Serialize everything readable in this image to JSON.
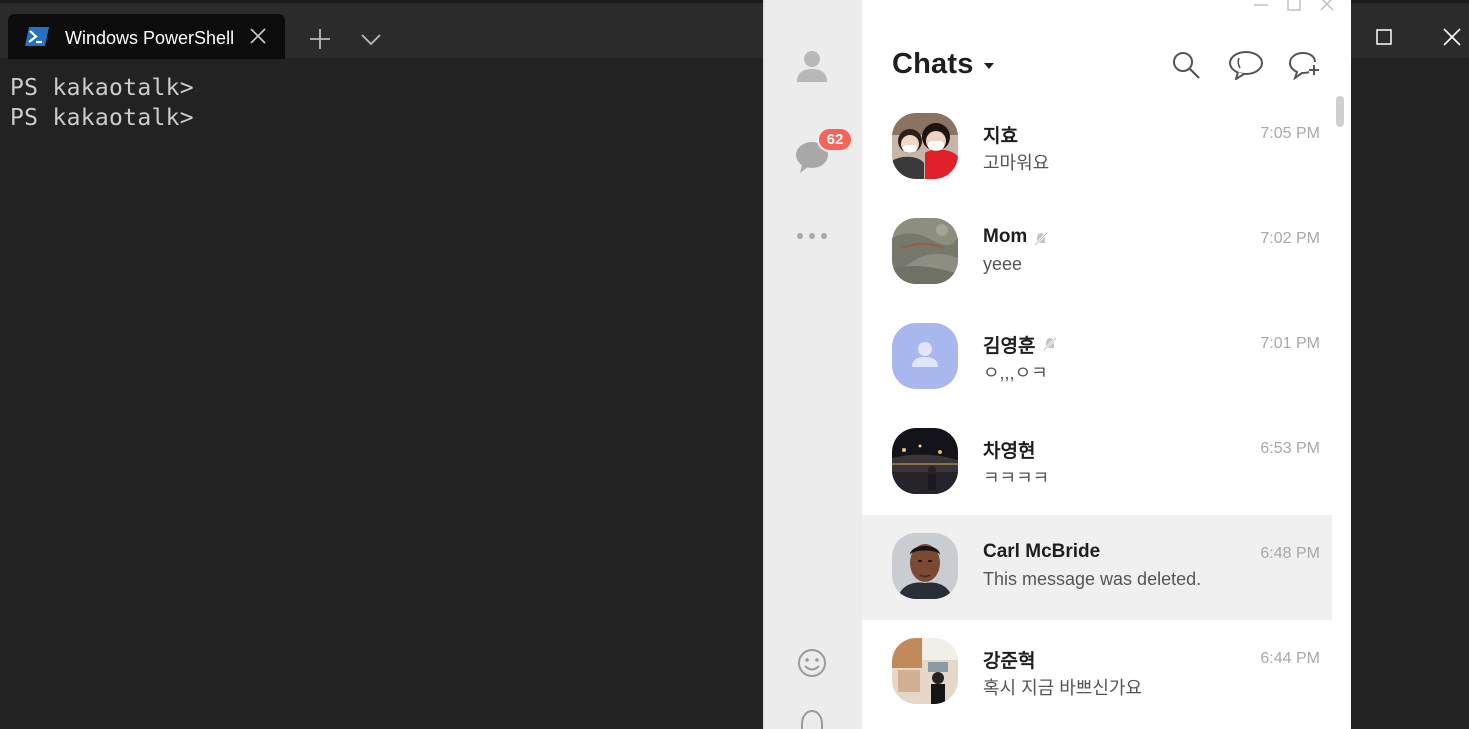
{
  "terminal": {
    "tab_title": "Windows PowerShell",
    "lines": [
      "PS kakaotalk>",
      "PS kakaotalk>"
    ],
    "background": "#0c0c0c"
  },
  "kakao": {
    "title": "Chats",
    "sidebar": {
      "unread_badge": "62",
      "items": [
        "person-icon",
        "chat-bubble-icon",
        "more-dots-icon",
        "emoticon-icon",
        "bell-icon"
      ]
    },
    "toolbar_icons": [
      "search-icon",
      "open-chat-icon",
      "new-chat-icon"
    ],
    "chats": [
      {
        "name": "지효",
        "preview": "고마워요",
        "time": "7:05 PM",
        "muted": false
      },
      {
        "name": "Mom",
        "preview": "yeee",
        "time": "7:02 PM",
        "muted": true
      },
      {
        "name": "김영훈",
        "preview": "ㅇ,,,ㅇㅋ",
        "time": "7:01 PM",
        "muted": true
      },
      {
        "name": "차영현",
        "preview": "ㅋㅋㅋㅋ",
        "time": "6:53 PM",
        "muted": false
      },
      {
        "name": "Carl McBride",
        "preview": "This message was deleted.",
        "time": "6:48 PM",
        "muted": false
      },
      {
        "name": "강준혁",
        "preview": "혹시 지금 바쁘신가요",
        "time": "6:44 PM",
        "muted": false
      }
    ],
    "colors": {
      "badge": "#f4645a",
      "sidebar": "#ececec",
      "selected_row": "#f0f0f0"
    }
  }
}
